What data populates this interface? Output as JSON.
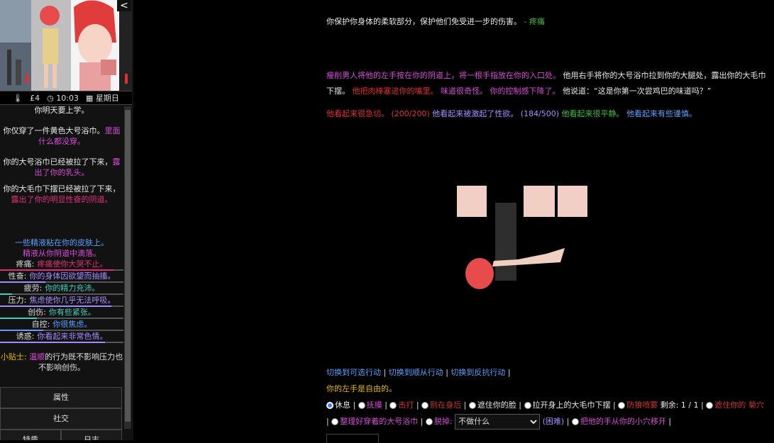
{
  "sidebar": {
    "collapse_label": "<",
    "status": {
      "temp": "£4",
      "time": "10:03",
      "weekday": "星期日"
    },
    "messages": [
      {
        "text": "你明天要上学。",
        "color": "#e8e8e8"
      },
      {
        "text": "你仅穿了一件黄色大号浴巾。",
        "color": "#e8e8e8",
        "extra": "里面什么都没穿。",
        "extra_color": "#d84bd8"
      },
      {
        "text": "你的大号浴巾已经被拉了下来，",
        "color": "#e8e8e8",
        "extra": "露出了你的乳头。",
        "extra_color": "#d84bd8"
      },
      {
        "text": "你的大毛巾下摆已经被拉了下来，",
        "color": "#e8e8e8",
        "extra": "露出了你的明显性奋的阴道。",
        "extra_color": "#e0307a"
      },
      {
        "text": "一些精液粘在你的皮肤上。",
        "color": "#5aa0ff"
      },
      {
        "text": "精液从你阴道中滴落。",
        "color": "#d84bd8"
      }
    ],
    "stats": [
      {
        "label": "疼痛:",
        "value": "疼痛使你大哭不止。",
        "color": "#e0307a",
        "level": 0.92
      },
      {
        "label": "性奋:",
        "value": "你的身体因欲望而抽搐。",
        "color": "#a68bff",
        "level": 0.37
      },
      {
        "label": "疲劳:",
        "value": "你的精力充沛。",
        "color": "#40d0c0",
        "level": 0.1
      },
      {
        "label": "压力:",
        "value": "焦虑使你几乎无法呼吸。",
        "color": "#a68bff",
        "level": 0.9
      },
      {
        "label": "创伤:",
        "value": "你有些紧张。",
        "color": "#40d0c0",
        "level": 0.3
      },
      {
        "label": "自控:",
        "value": "你很焦虑。",
        "color": "#5aa0ff",
        "level": 0.35
      },
      {
        "label": "诱惑:",
        "value": "你看起来非常色情。",
        "color": "#a68bff",
        "level": 0.85
      }
    ],
    "tip": {
      "label": "小贴士:",
      "highlight": "温顺",
      "rest": "的行为既不影响压力也不影响创伤。"
    },
    "buttons": {
      "attributes": "属性",
      "social": "社交",
      "traits": "特质",
      "journal": "日志"
    }
  },
  "main": {
    "line1": "你保护你身体的柔软部分，保护他们免受进一步的伤害。",
    "line1_tag": "- 疼痛",
    "para2_a": "瘦削男人将他的左手按在你的阴道上，将一根手指放在你的入口处。",
    "para2_b": "他用右手将你的大号浴巾拉到你的大腿处，露出你的大毛巾下摆。",
    "para2_c": "他把肉棒塞进你的嘴里。",
    "para2_d": "味道很奇怪。",
    "para2_e": "你的控制感下降了。",
    "para2_f": "他说道：“这是你第一次尝鸡巴的味道吗？”",
    "status_a": "他看起来很急切。",
    "status_b": "(200/200)",
    "status_c": "他看起来被激起了性欲。",
    "status_d": "(184/500)",
    "status_e": "他看起来很平静。",
    "status_f": "他看起来有些谨慎。"
  },
  "actions": {
    "modes": [
      "切换到可选行动",
      "切换到顺从行动",
      "切换到反抗行动"
    ],
    "free_hand": "你的左手是自由的。",
    "options_row1": [
      {
        "label": "休息",
        "color": "#e8e8e8",
        "selected": true
      },
      {
        "label": "抚摸",
        "color": "#d84bd8"
      },
      {
        "label": "击打",
        "color": "#e03030"
      },
      {
        "label": "别在身后",
        "color": "#e03030"
      },
      {
        "label": "遮住你的脸",
        "color": "#e8e8e8"
      },
      {
        "label": "拉开身上的大毛巾下摆",
        "color": "#e8e8e8"
      },
      {
        "label": "防狼喷雾",
        "color": "#e03030"
      }
    ],
    "remaining": "剩余: 1 / 1",
    "options_row2_a": "遮住你的",
    "options_row2_b": "菊穴",
    "tidy_label": "整理好穿着的大号浴巾",
    "remove_label": "脱掉:",
    "select_value": "不做什么",
    "difficulty": "(困难)",
    "move_hand": "把他的手从你的小穴移开"
  }
}
